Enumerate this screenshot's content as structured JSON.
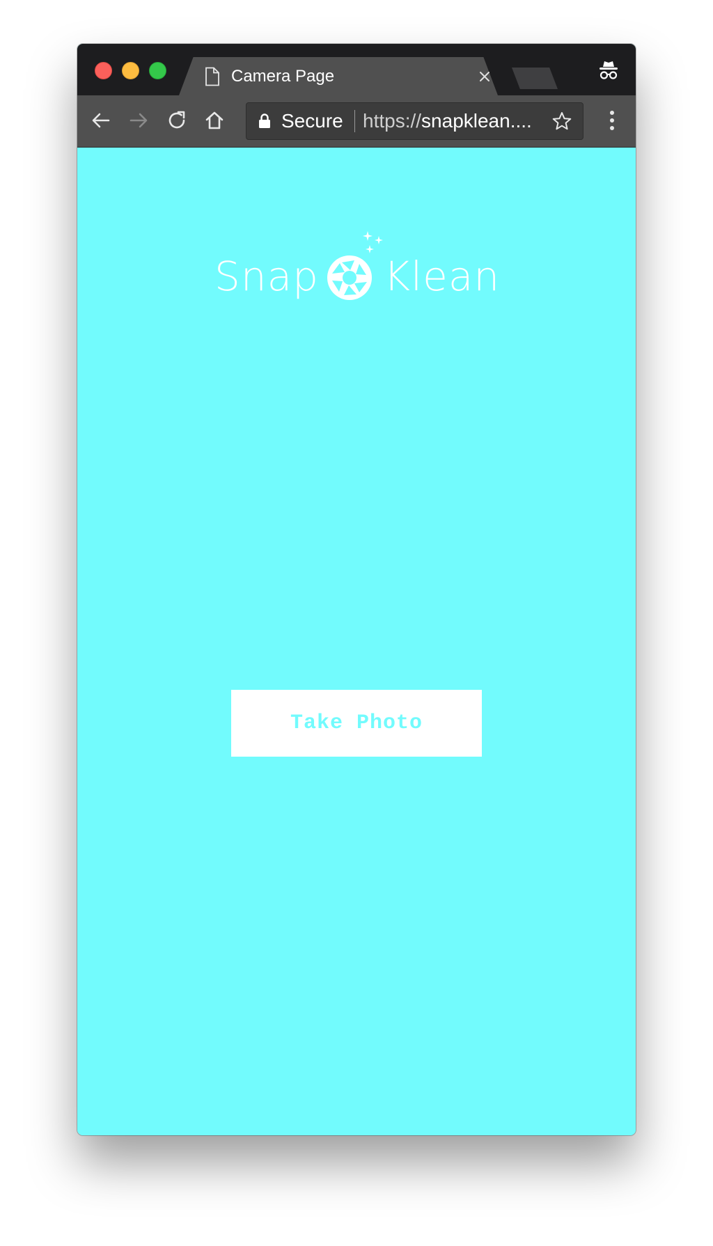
{
  "browser": {
    "tab": {
      "title": "Camera Page",
      "icon": "page-icon",
      "close_icon": "close-icon"
    },
    "toolbar": {
      "back_icon": "back-arrow-icon",
      "forward_icon": "forward-arrow-icon",
      "reload_icon": "reload-icon",
      "home_icon": "home-icon",
      "security_label": "Secure",
      "url_scheme": "https://",
      "url_rest": "snapklean....",
      "bookmark_icon": "star-icon",
      "menu_icon": "three-dot-menu-icon"
    },
    "profile_icon": "incognito-icon"
  },
  "page": {
    "background_color": "#72fbfd",
    "logo": {
      "word_left": "Snap",
      "word_right": "Klean",
      "icon": "camera-aperture-icon"
    },
    "take_photo_button": {
      "label": "Take Photo",
      "background": "#ffffff",
      "text_color": "#72fbfd"
    }
  }
}
